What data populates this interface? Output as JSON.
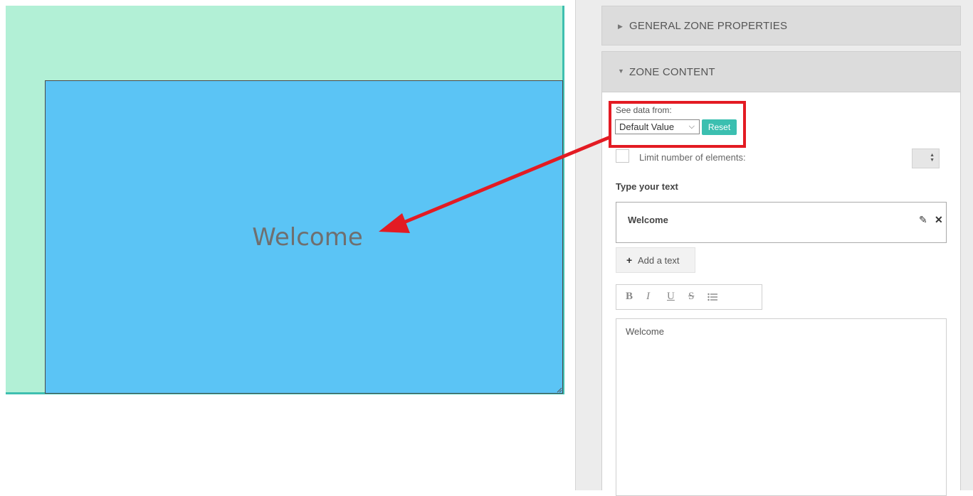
{
  "canvas": {
    "zone_text": "Welcome",
    "outer_zone_color": "#b2f0d6",
    "inner_zone_color": "#5bc4f5"
  },
  "panel": {
    "sections": [
      {
        "title": "GENERAL ZONE PROPERTIES",
        "icon": "caret-right-icon",
        "expanded": false
      },
      {
        "title": "ZONE CONTENT",
        "icon": "caret-down-icon",
        "expanded": true
      }
    ],
    "see_data": {
      "label": "See data from:",
      "selected": "Default Value",
      "reset_label": "Reset"
    },
    "limit": {
      "label": "Limit number of elements:",
      "checked": false
    },
    "type_text_label": "Type your text",
    "text_items": [
      {
        "label": "Welcome"
      }
    ],
    "add_text_label": "Add a text",
    "format_toolbar": [
      "B",
      "I",
      "U",
      "S",
      "list"
    ],
    "editor_text": "Welcome"
  },
  "annotation": {
    "highlight_color": "#e31b23"
  }
}
